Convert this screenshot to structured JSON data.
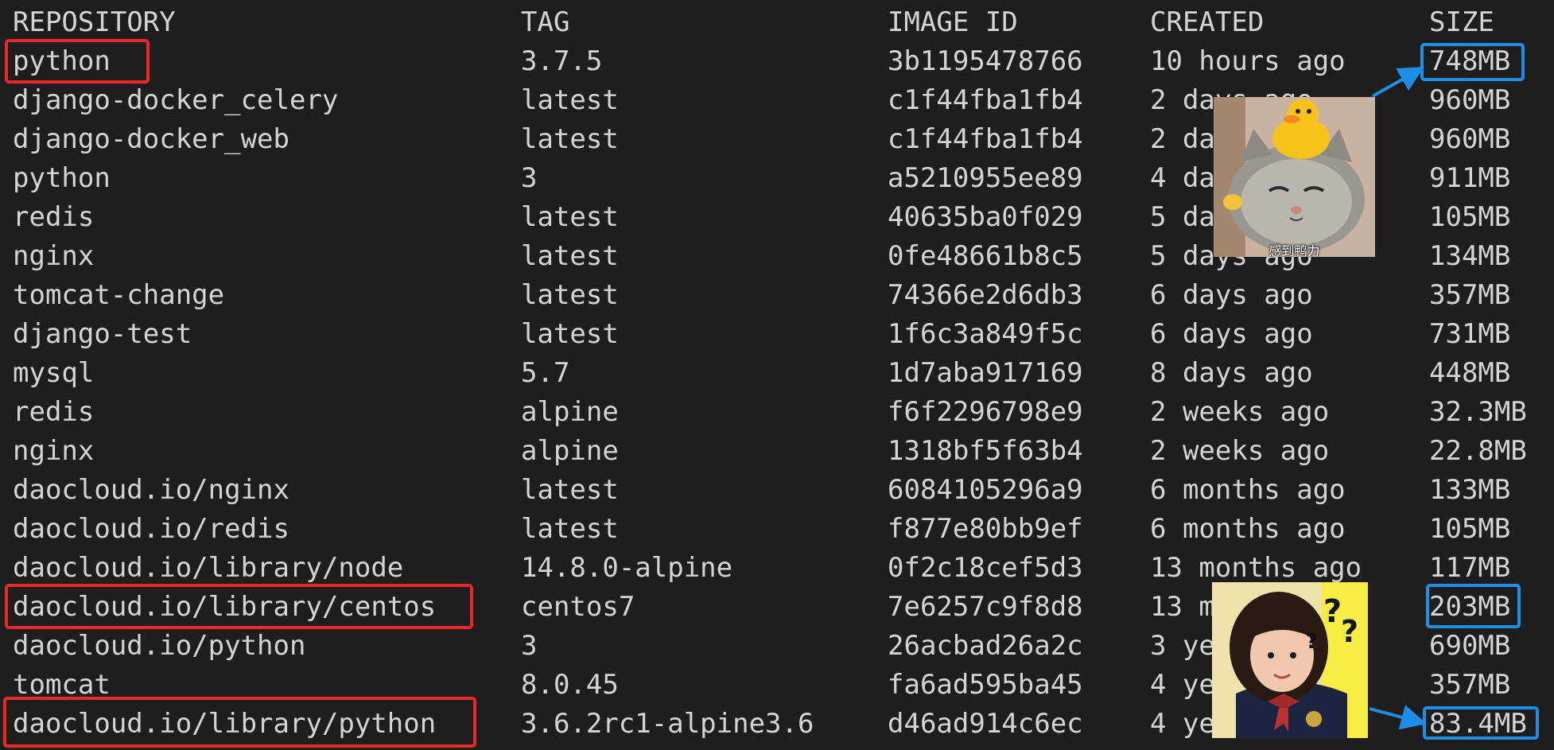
{
  "headers": {
    "repository": "REPOSITORY",
    "tag": "TAG",
    "image_id": "IMAGE ID",
    "created": "CREATED",
    "size": "SIZE"
  },
  "rows": [
    {
      "repository": "python",
      "tag": "3.7.5",
      "image_id": "3b1195478766",
      "created": "10 hours ago",
      "size": "748MB"
    },
    {
      "repository": "django-docker_celery",
      "tag": "latest",
      "image_id": "c1f44fba1fb4",
      "created": "2 days ago",
      "size": "960MB"
    },
    {
      "repository": "django-docker_web",
      "tag": "latest",
      "image_id": "c1f44fba1fb4",
      "created": "2 days ago",
      "size": "960MB"
    },
    {
      "repository": "python",
      "tag": "3",
      "image_id": "a5210955ee89",
      "created": "4 days ago",
      "size": "911MB"
    },
    {
      "repository": "redis",
      "tag": "latest",
      "image_id": "40635ba0f029",
      "created": "5 days ago",
      "size": "105MB"
    },
    {
      "repository": "nginx",
      "tag": "latest",
      "image_id": "0fe48661b8c5",
      "created": "5 days ago",
      "size": "134MB"
    },
    {
      "repository": "tomcat-change",
      "tag": "latest",
      "image_id": "74366e2d6db3",
      "created": "6 days ago",
      "size": "357MB"
    },
    {
      "repository": "django-test",
      "tag": "latest",
      "image_id": "1f6c3a849f5c",
      "created": "6 days ago",
      "size": "731MB"
    },
    {
      "repository": "mysql",
      "tag": "5.7",
      "image_id": "1d7aba917169",
      "created": "8 days ago",
      "size": "448MB"
    },
    {
      "repository": "redis",
      "tag": "alpine",
      "image_id": "f6f2296798e9",
      "created": "2 weeks ago",
      "size": "32.3MB"
    },
    {
      "repository": "nginx",
      "tag": "alpine",
      "image_id": "1318bf5f63b4",
      "created": "2 weeks ago",
      "size": "22.8MB"
    },
    {
      "repository": "daocloud.io/nginx",
      "tag": "latest",
      "image_id": "6084105296a9",
      "created": "6 months ago",
      "size": "133MB"
    },
    {
      "repository": "daocloud.io/redis",
      "tag": "latest",
      "image_id": "f877e80bb9ef",
      "created": "6 months ago",
      "size": "105MB"
    },
    {
      "repository": "daocloud.io/library/node",
      "tag": "14.8.0-alpine",
      "image_id": "0f2c18cef5d3",
      "created": "13 months ago",
      "size": "117MB"
    },
    {
      "repository": "daocloud.io/library/centos",
      "tag": "centos7",
      "image_id": "7e6257c9f8d8",
      "created": "13 months ago",
      "size": "203MB"
    },
    {
      "repository": "daocloud.io/python",
      "tag": "3",
      "image_id": "26acbad26a2c",
      "created": "3 years ago",
      "size": "690MB"
    },
    {
      "repository": "tomcat",
      "tag": "8.0.45",
      "image_id": "fa6ad595ba45",
      "created": "4 years ago",
      "size": "357MB"
    },
    {
      "repository": "daocloud.io/library/python",
      "tag": "3.6.2rc1-alpine3.6",
      "image_id": "d46ad914c6ec",
      "created": "4 years ago",
      "size": "83.4MB"
    }
  ],
  "stickers": {
    "cat_caption": "感到鸭力",
    "girl_marks": [
      "?",
      "?",
      "?"
    ]
  },
  "colors": {
    "background": "#1e1e1e",
    "text": "#d4d4d4",
    "highlight_red": "#e8282b",
    "highlight_blue": "#1e8fe8"
  }
}
